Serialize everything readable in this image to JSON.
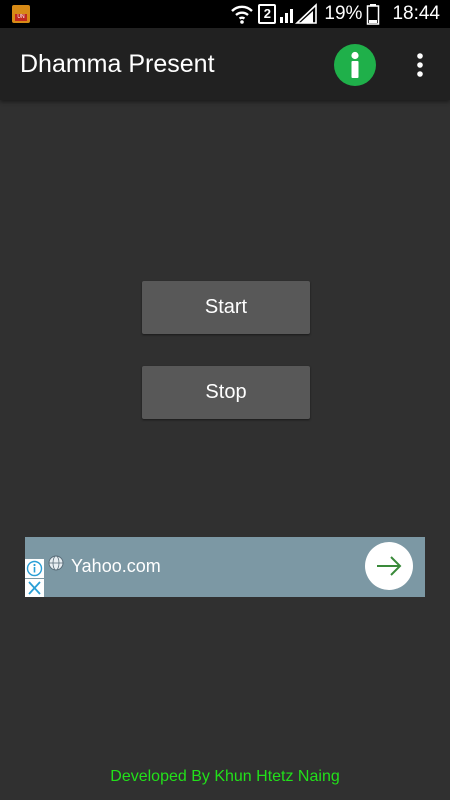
{
  "status_bar": {
    "app_icon_text": "UN",
    "sim_label": "2",
    "battery_percent": "19%",
    "time": "18:44",
    "icons": [
      "app-notification-icon",
      "wifi-icon",
      "signal-icon",
      "battery-icon"
    ]
  },
  "app_bar": {
    "title": "Dhamma Present",
    "info_icon": "info-icon",
    "menu_icon": "overflow-menu-icon"
  },
  "main": {
    "start_label": "Start",
    "stop_label": "Stop"
  },
  "ad": {
    "title": "Yahoo.com",
    "icons": [
      "globe-icon",
      "arrow-right-icon",
      "ad-choices-icon",
      "close-icon"
    ]
  },
  "footer": {
    "credit": "Developed By Khun Htetz Naing"
  },
  "colors": {
    "background": "#303030",
    "app_bar": "#212121",
    "button": "#585858",
    "info_green": "#1fb04a",
    "ad_banner": "#7c98a4",
    "footer_text": "#22e01a"
  }
}
